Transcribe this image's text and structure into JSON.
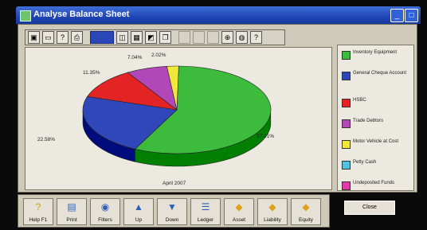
{
  "window": {
    "title": "Analyse Balance Sheet"
  },
  "toolbar": {
    "tools": [
      "save-icon",
      "monitor-icon",
      "help-icon",
      "print-icon",
      "color-dropdown",
      "print-preview-icon",
      "grid-icon",
      "chart-icon",
      "copy-icon",
      "blank",
      "blank",
      "blank",
      "zoom-icon",
      "redraw-icon",
      "question-icon"
    ]
  },
  "chart_data": {
    "type": "pie",
    "title": "",
    "footer": "April 2007",
    "slices": [
      {
        "label": "Inventory Equipment",
        "value": 57.01,
        "color": "#3dbb3d"
      },
      {
        "label": "General Cheque Account",
        "value": 22.58,
        "color": "#2f47b8"
      },
      {
        "label": "HSBC",
        "value": 11.35,
        "color": "#e22424"
      },
      {
        "label": "Trade Debtors",
        "value": 7.04,
        "color": "#b247b8"
      },
      {
        "label": "Motor Vehicle at Cost",
        "value": 2.02,
        "color": "#f1e63a"
      },
      {
        "label": "Petty Cash",
        "value": 0,
        "color": "#53c2e0"
      },
      {
        "label": "Undeposited Funds",
        "value": 0,
        "color": "#e13aa6"
      }
    ],
    "percent_labels": [
      "57.01%",
      "22.58%",
      "11.35%",
      "7.04%",
      "2.02%"
    ]
  },
  "bottom_buttons": [
    {
      "label": "Help F1",
      "icon": "question-icon"
    },
    {
      "label": "Print",
      "icon": "printer-icon"
    },
    {
      "label": "Filters",
      "icon": "eye-icon"
    },
    {
      "label": "Up",
      "icon": "up-arrow-icon"
    },
    {
      "label": "Down",
      "icon": "down-arrow-icon"
    },
    {
      "label": "Ledger",
      "icon": "ledger-icon"
    },
    {
      "label": "Asset",
      "icon": "asset-icon"
    },
    {
      "label": "Liability",
      "icon": "liability-icon"
    },
    {
      "label": "Equity",
      "icon": "equity-icon"
    }
  ],
  "close_label": "Close"
}
